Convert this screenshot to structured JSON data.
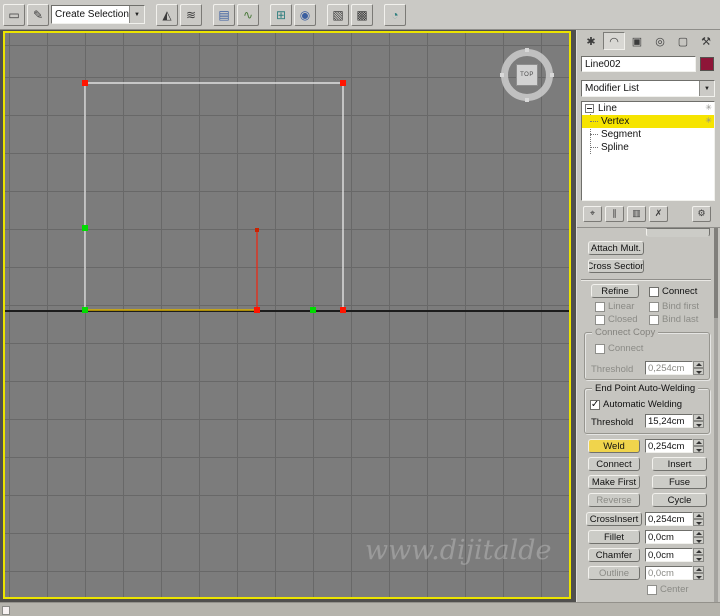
{
  "toolbar": {
    "named_selection_combo": "Create Selection Se"
  },
  "viewport": {
    "view_label": "TOP",
    "watermark": "www.dijitalde"
  },
  "panel": {
    "object_name": "Line002",
    "modifier_list_label": "Modifier List",
    "stack_root": "Line",
    "stack_items": [
      "Vertex",
      "Segment",
      "Spline"
    ],
    "rollout": {
      "attach_mult": "Attach Mult.",
      "cross_section": "Cross Section",
      "refine": "Refine",
      "connect_checkbox": "Connect",
      "linear": "Linear",
      "bind_first": "Bind first",
      "closed": "Closed",
      "bind_last": "Bind last",
      "connect_copy_title": "Connect Copy",
      "connect_copy_checkbox": "Connect",
      "threshold_label": "Threshold",
      "connect_copy_threshold": "0,254cm",
      "end_point_title": "End Point Auto-Welding",
      "automatic_welding": "Automatic Welding",
      "weld_threshold": "15,24cm",
      "weld": "Weld",
      "weld_value": "0,254cm",
      "connect": "Connect",
      "insert": "Insert",
      "make_first": "Make First",
      "fuse": "Fuse",
      "reverse": "Reverse",
      "cycle": "Cycle",
      "cross_insert": "CrossInsert",
      "cross_insert_value": "0,254cm",
      "fillet": "Fillet",
      "fillet_value": "0,0cm",
      "chamfer": "Chamfer",
      "chamfer_value": "0,0cm",
      "outline": "Outline",
      "outline_value": "0,0cm",
      "center": "Center"
    }
  },
  "colors": {
    "active_viewport_border": "#ece400",
    "object_color_swatch": "#8e1538",
    "selected_vertex": "#ff1400",
    "end_point_vertex": "#00dc00",
    "selected_subobject_highlight": "#f6e400",
    "active_weld_button": "#f0d44c"
  },
  "icons": {
    "selection_region": "▭",
    "edit_named_selections": "✎",
    "mirror": "◭",
    "align": "≋",
    "layer_manager": "▤",
    "curve_editor": "∿",
    "schematic_view": "⊞",
    "material_editor": "◉",
    "render_setup": "▧",
    "rendered_frame": "▩",
    "quick_render": "◔",
    "dropdown_arrow": "▼",
    "check": "✓",
    "stack_ticks": "✳",
    "tab_create": "✱",
    "tab_modify": "◠",
    "tab_hierarchy": "▣",
    "tab_motion": "◎",
    "tab_display": "▢",
    "tab_utilities": "⚒",
    "pin_stack": "⌖",
    "show_end_result": "∥",
    "make_unique": "▥",
    "remove_modifier": "✗",
    "configure_sets": "⚙"
  }
}
